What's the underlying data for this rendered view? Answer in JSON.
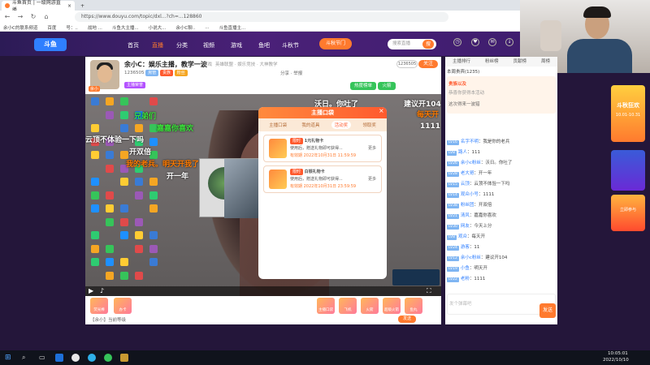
{
  "browser": {
    "tabs": [
      {
        "title": "斗鱼首页 | 一级网游直播"
      },
      {
        "title": ""
      }
    ],
    "url": "https://www.douyu.com/topic/dxl...?ch=...128860",
    "bookmarks": [
      "余小C的联系频道",
      "百度",
      "号：..",
      "战地 ...",
      "斗鱼大主播...",
      "小说大...",
      "余小C聊..",
      "...",
      "斗鱼直播主..."
    ]
  },
  "site_header": {
    "logo": "斗鱼",
    "nav": [
      "首页",
      "直播",
      "分类",
      "视频",
      "游戏",
      "鱼吧",
      "斗秋节"
    ],
    "promo": "斗秋节门",
    "search_placeholder": "搜索直播",
    "search_button": "搜"
  },
  "room": {
    "streamer_name": "余小C：娱乐主播，教学一波",
    "category": "游戏",
    "subline": "英雄联盟 · 娱乐竞技 · 大神教学",
    "room_id": "1236505",
    "follow_label": "关注",
    "badges": [
      "房管",
      "贵族",
      "粉丝",
      "主播荣誉"
    ],
    "share_label": "分享",
    "report_label": "举报",
    "hot_label": "热度榜单",
    "rank_label": "火箭",
    "avatar_tags": [
      "余小",
      "正在"
    ]
  },
  "danmu": [
    {
      "text": "沃日。你吐了",
      "color": "white"
    },
    {
      "text": "建议开104",
      "color": "white"
    },
    {
      "text": "每天开",
      "color": "orange"
    },
    {
      "text": "1111",
      "color": "white"
    },
    {
      "text": "兄弟们",
      "color": "green"
    },
    {
      "text": "嘉嘉你喜欢",
      "color": "green"
    },
    {
      "text": "云顶不体验一下吗",
      "color": "white"
    },
    {
      "text": "开双倍",
      "color": "white"
    },
    {
      "text": "我的老兵。明天开我了",
      "color": "orange"
    },
    {
      "text": "开一年",
      "color": "white"
    }
  ],
  "modal": {
    "title": "主播口袋",
    "tabs": [
      "主播口袋",
      "我的道具",
      "活动奖",
      "领取奖"
    ],
    "cards": [
      {
        "tag": "限时",
        "name": "1元礼物卡",
        "desc": "使用后，赠送礼物即可获得...",
        "expiry": "有效期 2022年10月31日 11:59:59",
        "link": "更多"
      },
      {
        "tag": "限时",
        "name": "白银礼物卡",
        "desc": "使用后，赠送礼物即可获得...",
        "expiry": "有效期 2022年10月31日 23:59:59",
        "link": "更多"
      }
    ]
  },
  "bottombar": {
    "gifts": [
      "荧光棒",
      "办卡",
      "主播口袋",
      "飞机",
      "火箭",
      "超级火箭",
      "鱼丸"
    ],
    "chat_placeholder": "说点什么...",
    "send_label": "发送",
    "level_text": "【余小】当前等级"
  },
  "chat": {
    "header_tabs": [
      "主播排行",
      "粉丝榜",
      "贡献榜",
      "周榜"
    ],
    "rank_line": "本周贵宾(1235)",
    "announcement": "这次得来一波猎",
    "event_title": "贵族以及",
    "event_sub": "恭喜你获得本活动",
    "messages": [
      {
        "lv": "LV16",
        "user": "名字不明",
        "text": "我是你的老兵"
      },
      {
        "lv": "LV8",
        "user": "路人",
        "text": "111"
      },
      {
        "lv": "LV26",
        "user": "余小c粉丝",
        "text": "沃日。你吐了"
      },
      {
        "lv": "LV28",
        "user": "老大哥",
        "text": "开一年"
      },
      {
        "lv": "LV15",
        "user": "云顶",
        "text": "云顶不体验一下吗"
      },
      {
        "lv": "LV14",
        "user": "观众小号",
        "text": "1111"
      },
      {
        "lv": "LV38",
        "user": "粉丝团",
        "text": "开双倍"
      },
      {
        "lv": "LV21",
        "user": "清风",
        "text": "嘉嘉你喜欢"
      },
      {
        "lv": "LV30",
        "user": "网友",
        "text": "今天上分"
      },
      {
        "lv": "LV8",
        "user": "观众",
        "text": "每天开"
      },
      {
        "lv": "LV24",
        "user": "游客",
        "text": "11"
      },
      {
        "lv": "LV12",
        "user": "余小c粉丝",
        "text": "建议开104"
      },
      {
        "lv": "LV19",
        "user": "小鱼",
        "text": "明天开"
      },
      {
        "lv": "LV22",
        "user": "老粉",
        "text": "1111"
      }
    ],
    "input_placeholder": "发个弹幕吧",
    "send_label": "发送"
  },
  "side_ad": {
    "title": "斗秋狂欢",
    "sub": "10.01-10.31",
    "cta": "立即参与"
  },
  "taskbar": {
    "time": "10:05:01",
    "date": "2022/10/10"
  },
  "colors": {
    "brand_orange": "#ff7a2e",
    "brand_blue": "#2f7fff",
    "header_purple": "#3a1c6a"
  }
}
